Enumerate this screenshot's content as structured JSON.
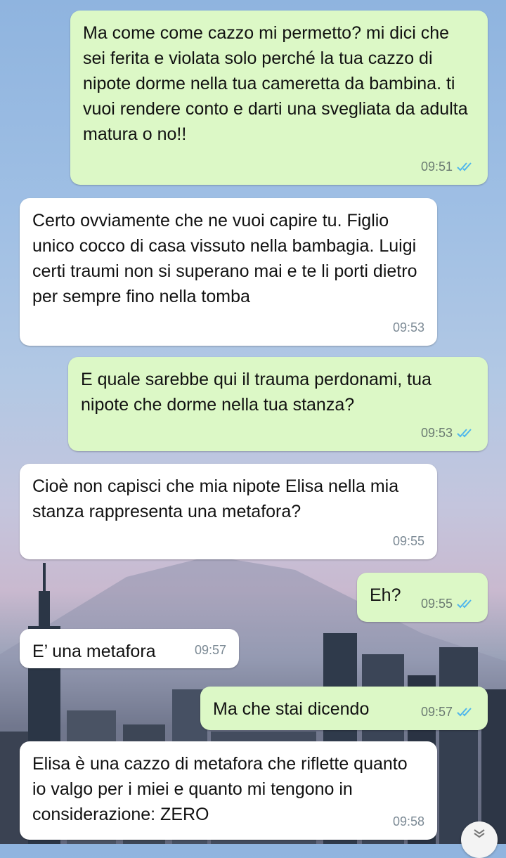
{
  "messages": [
    {
      "direction": "outgoing",
      "text": "Ma come come cazzo mi permetto? mi dici che sei ferita e violata solo perché la tua cazzo di nipote dorme nella tua cameretta da bambina. ti vuoi rendere conto e darti una svegliata da adulta matura o no!!",
      "time": "09:51",
      "status": "read"
    },
    {
      "direction": "incoming",
      "text": "Certo ovviamente che ne vuoi capire tu. Figlio unico cocco di casa vissuto nella bambagia. Luigi certi traumi non si superano mai e te li porti dietro per sempre fino nella tomba",
      "time": "09:53"
    },
    {
      "direction": "outgoing",
      "text": "E quale sarebbe qui il trauma perdonami, tua nipote che dorme nella tua stanza?",
      "time": "09:53",
      "status": "read"
    },
    {
      "direction": "incoming",
      "text": "Cioè non capisci che mia nipote Elisa nella mia stanza rappresenta una metafora?",
      "time": "09:55"
    },
    {
      "direction": "outgoing",
      "text": "Eh?",
      "time": "09:55",
      "status": "read"
    },
    {
      "direction": "incoming",
      "text": "E’ una metafora",
      "time": "09:57"
    },
    {
      "direction": "outgoing",
      "text": "Ma che stai dicendo",
      "time": "09:57",
      "status": "read"
    },
    {
      "direction": "incoming",
      "text": "Elisa è una cazzo di metafora che riflette quanto io valgo per i miei e quanto mi tengono in considerazione: ZERO",
      "time": "09:58"
    }
  ],
  "colors": {
    "outgoing_bubble": "#dcf8c6",
    "incoming_bubble": "#ffffff",
    "read_ticks": "#4fb6ec"
  },
  "icons": {
    "read_receipt": "double-check-icon",
    "scroll_down": "chevron-double-down-icon"
  }
}
